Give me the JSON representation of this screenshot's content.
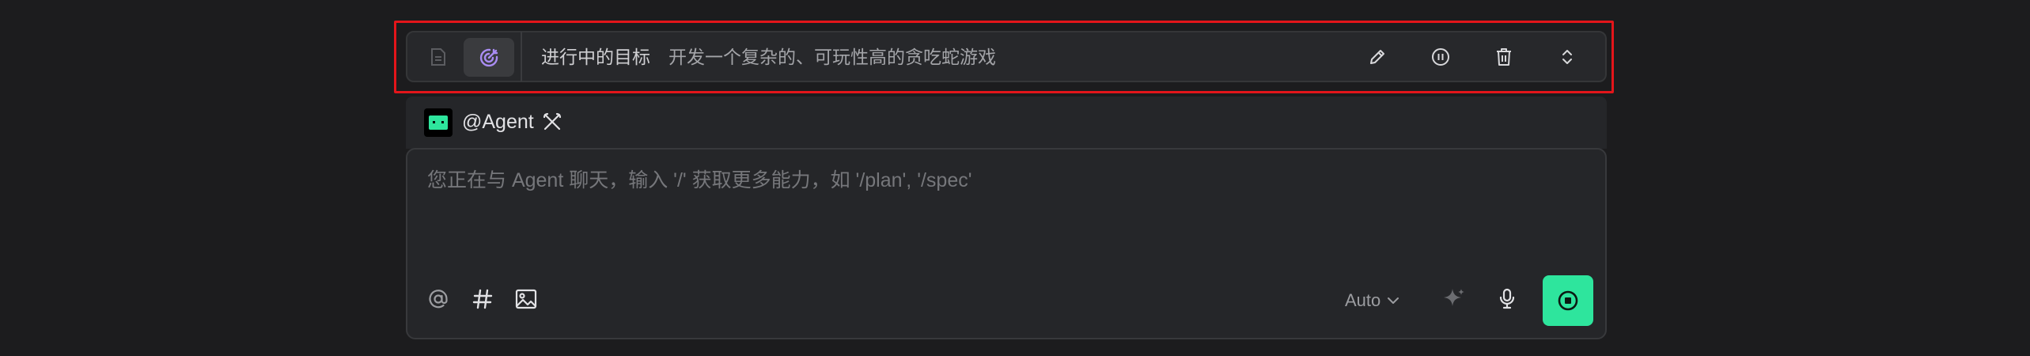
{
  "goal": {
    "title": "进行中的目标",
    "text": "开发一个复杂的、可玩性高的贪吃蛇游戏"
  },
  "agent": {
    "name": "@Agent"
  },
  "chat": {
    "placeholder": "您正在与 Agent 聊天，输入 '/' 获取更多能力，如 '/plan', '/spec'",
    "model": "Auto"
  },
  "icons": {
    "goal_actions": [
      "document-icon",
      "target-icon",
      "edit-pencil-icon",
      "pause-icon",
      "delete-trash-icon",
      "expand-collapse-icon"
    ],
    "agent": [
      "agent-avatar-icon",
      "tools-icon"
    ],
    "input_tools": [
      "mention-at-icon",
      "hashtag-icon",
      "image-icon",
      "sparkle-icon",
      "microphone-icon",
      "stop-icon"
    ]
  },
  "colors": {
    "background": "#1c1c1e",
    "highlight_outline": "#e3151a",
    "target_icon": "#a98cf2",
    "send_button": "#2ee59d",
    "avatar_green": "#2ee59d"
  }
}
